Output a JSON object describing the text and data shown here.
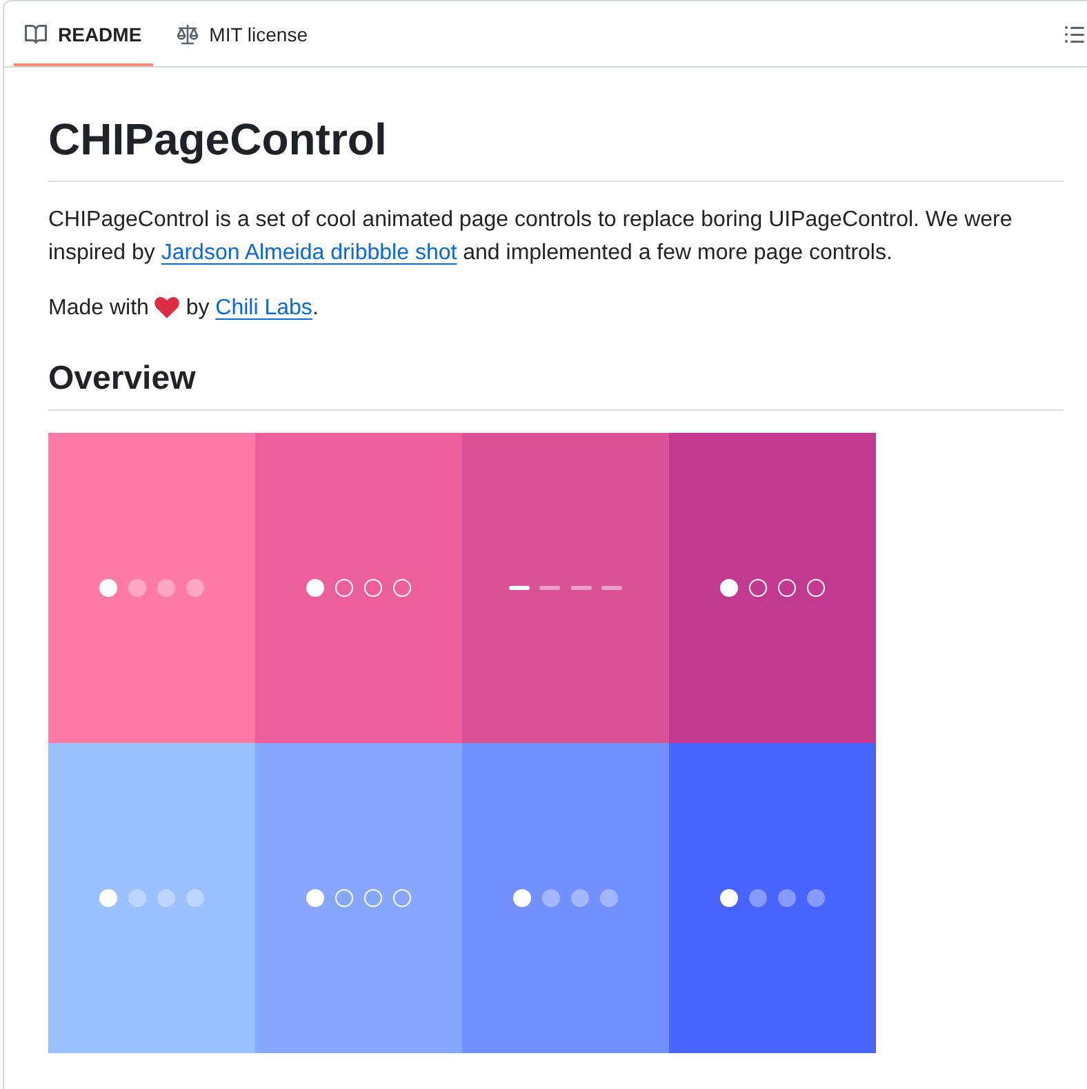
{
  "tabs": [
    {
      "kind": "book",
      "label": "README",
      "selected": true
    },
    {
      "kind": "scale",
      "label": "MIT license",
      "selected": false
    }
  ],
  "readme": {
    "title": "CHIPageControl",
    "paragraphs": [
      {
        "parts": [
          {
            "kind": "text",
            "text": "CHIPageControl is a set of cool animated page controls to replace boring UIPageControl. We were inspired by "
          },
          {
            "kind": "link",
            "text": "Jardson Almeida dribbble shot"
          },
          {
            "kind": "text",
            "text": " and implemented a few more page controls."
          }
        ]
      },
      {
        "parts": [
          {
            "kind": "text",
            "text": "Made with "
          },
          {
            "kind": "heart"
          },
          {
            "kind": "text",
            "text": " by "
          },
          {
            "kind": "link",
            "text": "Chili Labs"
          },
          {
            "kind": "text",
            "text": "."
          }
        ]
      }
    ],
    "sections": [
      {
        "heading": "Overview",
        "demo": {
          "tiles": [
            {
              "color": "#ff7aa6",
              "kind": "dot",
              "pages": [
                {
                  "selected": true
                },
                {
                  "selected": false
                },
                {
                  "selected": false
                },
                {
                  "selected": false
                }
              ]
            },
            {
              "color": "#ec5f9b",
              "kind": "ring",
              "pages": [
                {
                  "selected": true
                },
                {
                  "selected": false
                },
                {
                  "selected": false
                },
                {
                  "selected": false
                }
              ]
            },
            {
              "color": "#da5296",
              "kind": "dash",
              "pages": [
                {
                  "selected": true
                },
                {
                  "selected": false
                },
                {
                  "selected": false
                },
                {
                  "selected": false
                }
              ]
            },
            {
              "color": "#c23a8f",
              "kind": "ring",
              "pages": [
                {
                  "selected": true
                },
                {
                  "selected": false
                },
                {
                  "selected": false
                },
                {
                  "selected": false
                }
              ]
            },
            {
              "color": "#9bc0ff",
              "kind": "dot",
              "pages": [
                {
                  "selected": true
                },
                {
                  "selected": false
                },
                {
                  "selected": false
                },
                {
                  "selected": false
                }
              ]
            },
            {
              "color": "#87a7ff",
              "kind": "ring",
              "pages": [
                {
                  "selected": true
                },
                {
                  "selected": false
                },
                {
                  "selected": false
                },
                {
                  "selected": false
                }
              ]
            },
            {
              "color": "#7291ff",
              "kind": "dot",
              "pages": [
                {
                  "selected": true
                },
                {
                  "selected": false
                },
                {
                  "selected": false
                },
                {
                  "selected": false
                }
              ]
            },
            {
              "color": "#4864ff",
              "kind": "dot",
              "pages": [
                {
                  "selected": true
                },
                {
                  "selected": false
                },
                {
                  "selected": false
                },
                {
                  "selected": false
                }
              ]
            }
          ]
        }
      }
    ]
  }
}
